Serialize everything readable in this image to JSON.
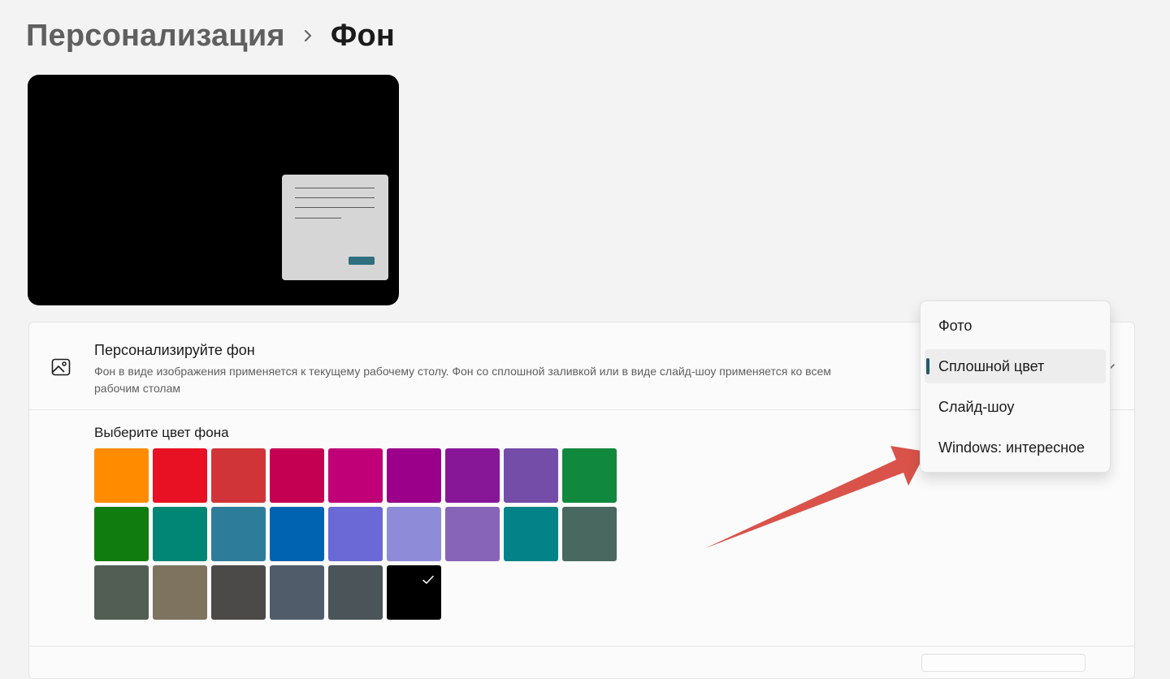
{
  "breadcrumb": {
    "parent": "Персонализация",
    "separator_icon": "chevron-right-icon",
    "current": "Фон"
  },
  "preview": {
    "background_color": "#000000",
    "window_color": "#d6d6d6",
    "accent_color": "#2f6f80"
  },
  "personalize": {
    "icon": "image-icon",
    "title": "Персонализируйте фон",
    "description": "Фон в виде изображения применяется к текущему рабочему столу. Фон со сплошной заливкой или в виде слайд-шоу применяется ко всем рабочим столам",
    "dropdown": {
      "options": [
        "Фото",
        "Сплошной цвет",
        "Слайд-шоу",
        "Windows: интересное"
      ],
      "selected": "Сплошной цвет"
    }
  },
  "colors": {
    "label": "Выберите цвет фона",
    "swatches": [
      "#ff8c00",
      "#e81123",
      "#d13438",
      "#c30052",
      "#bf0077",
      "#9a0089",
      "#881798",
      "#744da9",
      "#10893e",
      "#107c10",
      "#018574",
      "#2d7d9a",
      "#0063b1",
      "#6b69d6",
      "#8e8cd8",
      "#8764b8",
      "#038387",
      "#486860",
      "#525e54",
      "#7e735f",
      "#4c4a48",
      "#515c6b",
      "#4a5459",
      "#000000"
    ],
    "selected_color": "#000000"
  },
  "annotation": {
    "arrow_color": "#d9534a"
  }
}
